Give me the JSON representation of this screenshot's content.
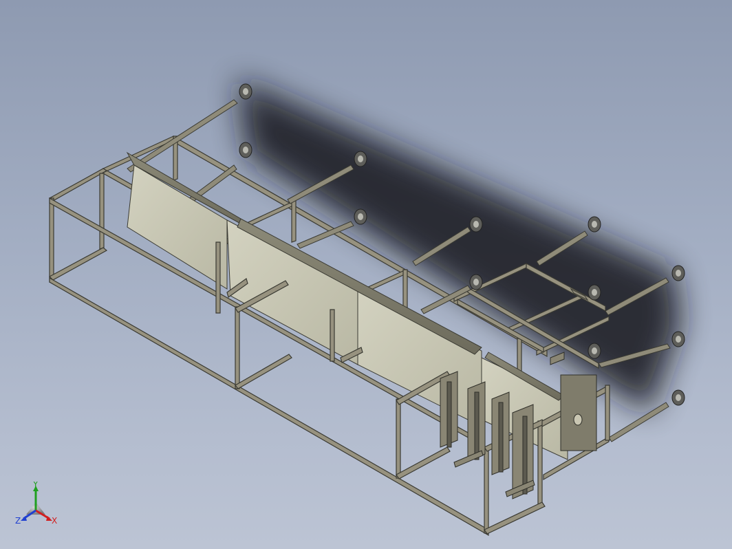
{
  "viewport": {
    "background_top": "#8e9ab1",
    "background_bottom": "#bcc4d4"
  },
  "model": {
    "frame_color": "#97927f",
    "frame_edge": "#3a3a33",
    "panel_color": "#c9c8b5",
    "shadow_color": "#111417",
    "leveling_feet_count": 11,
    "mechanism_icon": "gripper-mechanism"
  },
  "triad": {
    "x_label": "X",
    "y_label": "Y",
    "z_label": "Z",
    "x_color": "#d11f1f",
    "y_color": "#20a020",
    "z_color": "#2040d0"
  }
}
